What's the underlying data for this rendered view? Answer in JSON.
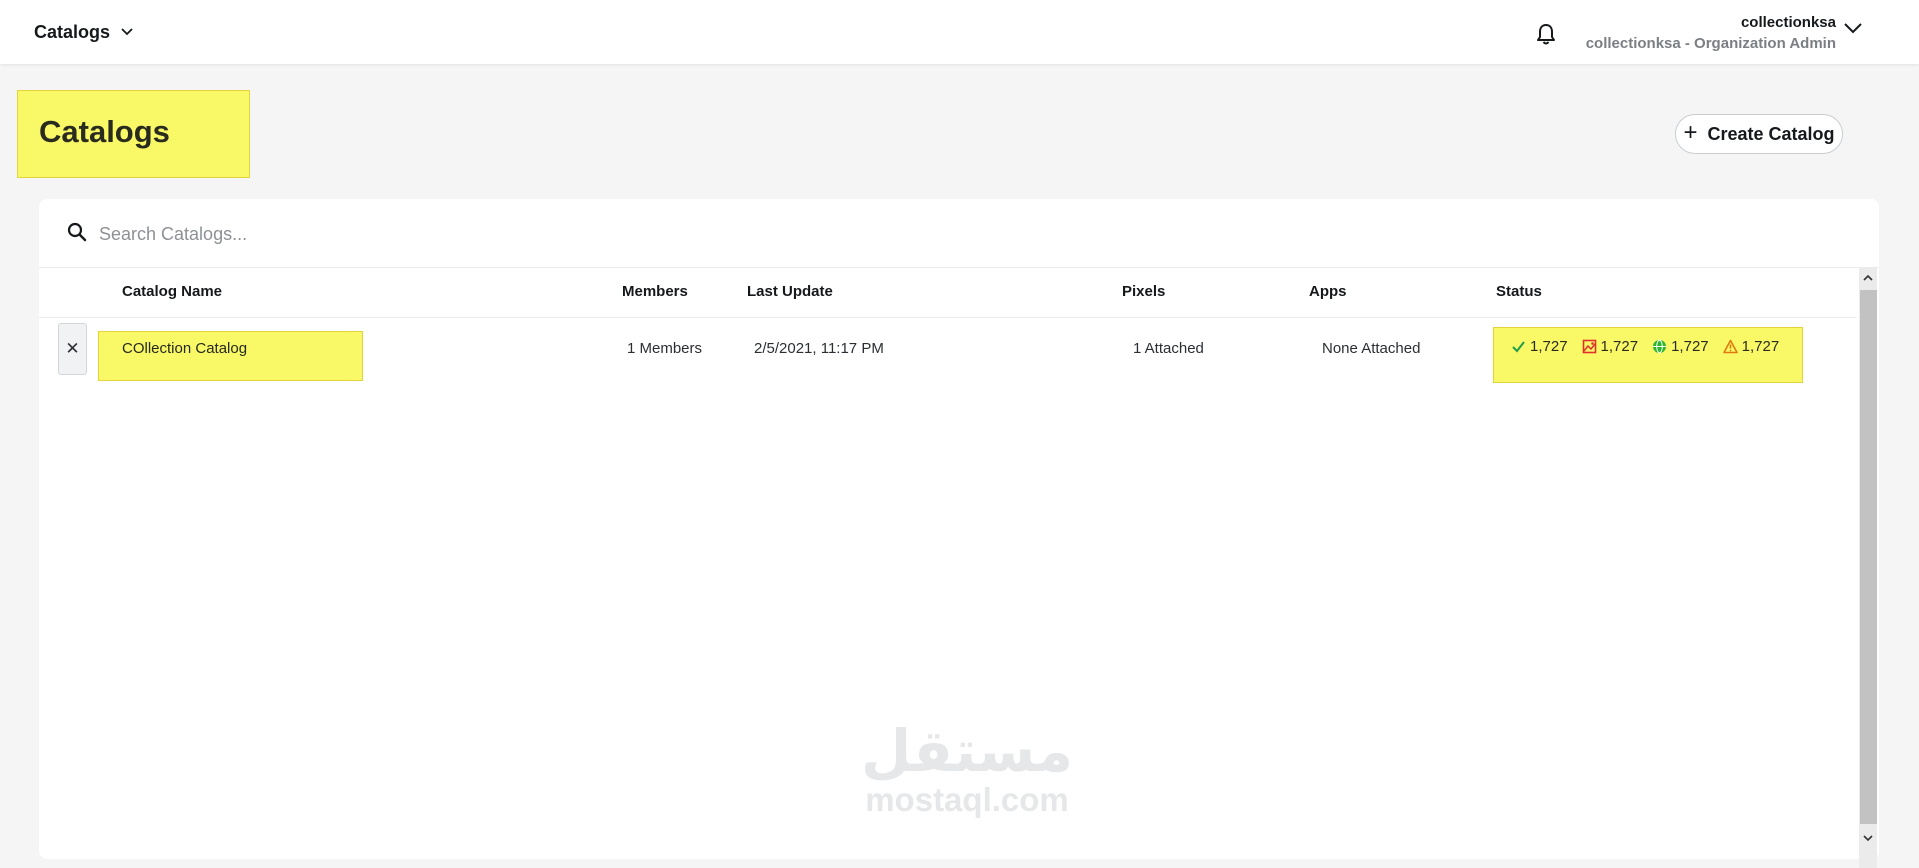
{
  "topbar": {
    "nav_label": "Catalogs",
    "account_name": "collectionksa",
    "account_role": "collectionksa - Organization Admin"
  },
  "page": {
    "title": "Catalogs",
    "create_button_label": "Create Catalog"
  },
  "search": {
    "placeholder": "Search Catalogs..."
  },
  "table": {
    "columns": [
      "Catalog Name",
      "Members",
      "Last Update",
      "Pixels",
      "Apps",
      "Status"
    ],
    "rows": [
      {
        "name": "COllection Catalog",
        "members": "1 Members",
        "last_update": "2/5/2021, 11:17 PM",
        "pixels": "1 Attached",
        "apps": "None Attached",
        "status": [
          {
            "icon": "check-icon",
            "value": "1,727",
            "color": "#1f9e48"
          },
          {
            "icon": "image-error-icon",
            "value": "1,727",
            "color": "#e0312d"
          },
          {
            "icon": "globe-icon",
            "value": "1,727",
            "color": "#2db52d"
          },
          {
            "icon": "warning-icon",
            "value": "1,727",
            "color": "#e07a10"
          }
        ]
      }
    ]
  },
  "watermark": {
    "arabic": "مستقل",
    "latin": "mostaql.com"
  },
  "colors": {
    "highlight": "#f9f967",
    "highlight_border": "#e4d43c",
    "background": "#f5f5f5"
  }
}
